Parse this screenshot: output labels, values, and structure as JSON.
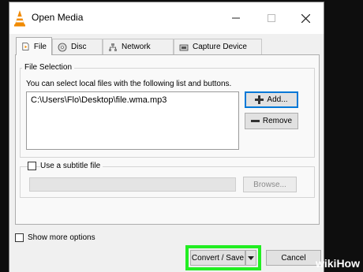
{
  "window": {
    "title": "Open Media",
    "minimize_icon": "minimize-icon",
    "maximize_icon": "maximize-icon",
    "close_icon": "close-icon"
  },
  "tabs": [
    {
      "label": "File",
      "icon": "file-icon",
      "active": true
    },
    {
      "label": "Disc",
      "icon": "disc-icon",
      "active": false
    },
    {
      "label": "Network",
      "icon": "network-icon",
      "active": false
    },
    {
      "label": "Capture Device",
      "icon": "capture-device-icon",
      "active": false
    }
  ],
  "file_selection": {
    "group_title": "File Selection",
    "description": "You can select local files with the following list and buttons.",
    "files": [
      "C:\\Users\\Flo\\Desktop\\file.wma.mp3"
    ],
    "add_label": "Add...",
    "remove_label": "Remove"
  },
  "subtitle": {
    "checkbox_label": "Use a subtitle file",
    "checked": false,
    "browse_label": "Browse..."
  },
  "footer": {
    "show_more_label": "Show more options",
    "show_more_checked": false,
    "convert_save_label": "Convert / Save",
    "cancel_label": "Cancel"
  },
  "watermark": {
    "wiki": "wiki",
    "how": "How"
  },
  "colors": {
    "highlight": "#22ee22",
    "focus_border": "#0078d7",
    "vlc_orange": "#f08a00"
  }
}
